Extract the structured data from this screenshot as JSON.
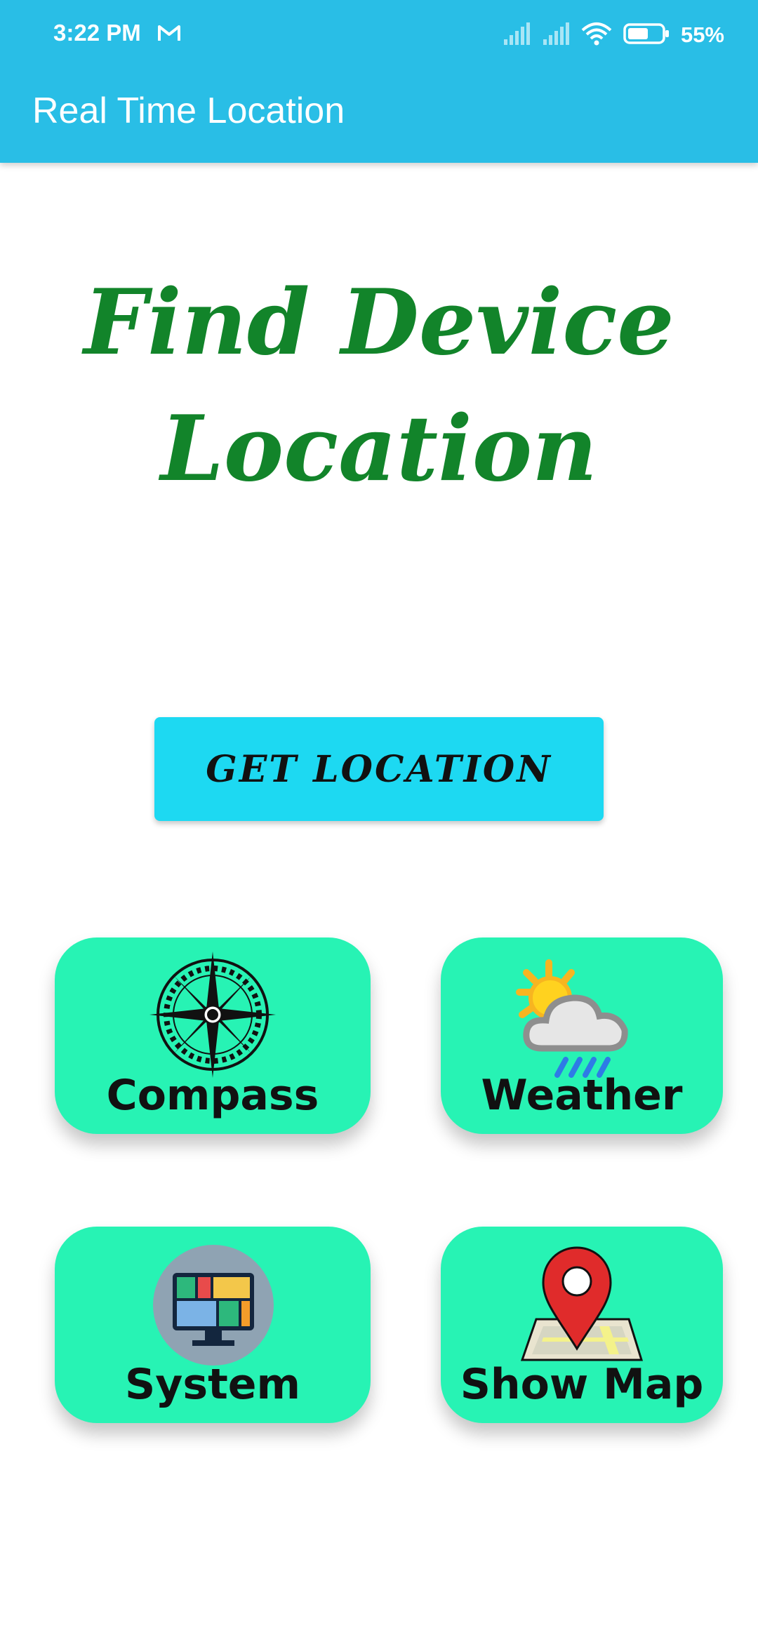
{
  "status_bar": {
    "time": "3:22 PM",
    "battery_percent": "55%",
    "icons": [
      "gmail-icon",
      "signal-icon",
      "signal-icon",
      "wifi-icon",
      "battery-icon"
    ]
  },
  "app_bar": {
    "title": "Real Time Location",
    "color": "#29BEE6"
  },
  "main": {
    "headline_line1": "Find Device",
    "headline_line2": "Location",
    "headline_color": "#12842A",
    "get_location_label": "GET LOCATION",
    "button_color": "#1DD9F2"
  },
  "tiles": {
    "color": "#27F3B4",
    "items": [
      {
        "label": "Compass",
        "icon": "compass-icon"
      },
      {
        "label": "Weather",
        "icon": "weather-icon"
      },
      {
        "label": "System",
        "icon": "monitor-icon"
      },
      {
        "label": "Show Map",
        "icon": "map-pin-icon"
      }
    ]
  }
}
